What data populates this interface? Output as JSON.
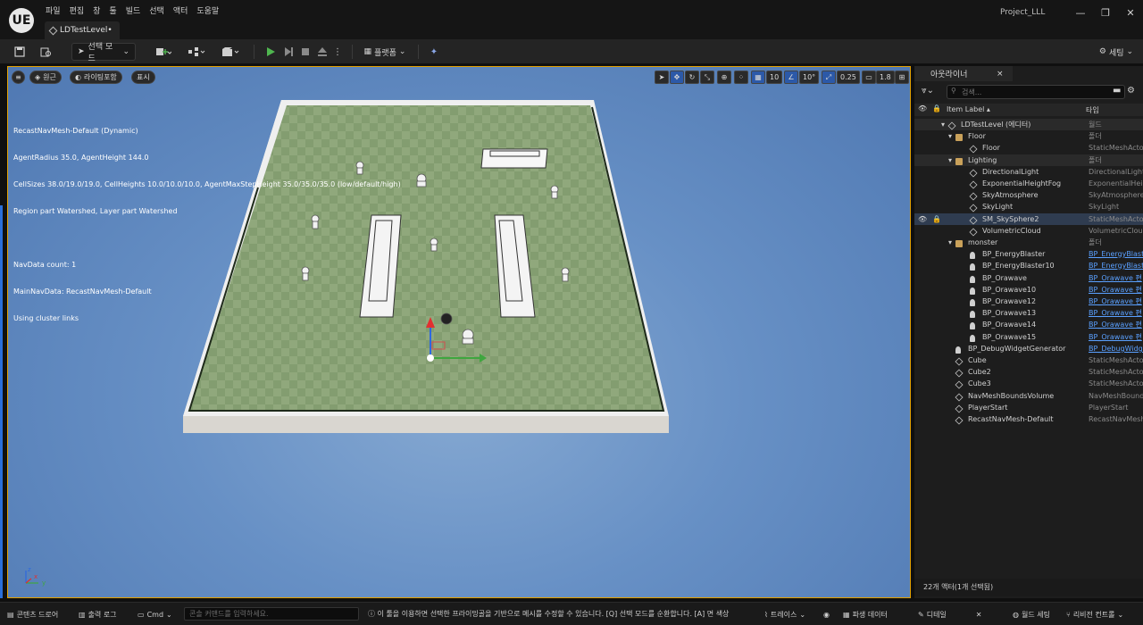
{
  "app": {
    "logo": "UE",
    "project_name": "Project_LLL",
    "menu": [
      "파일",
      "편집",
      "창",
      "툴",
      "빌드",
      "선택",
      "액터",
      "도움말"
    ],
    "level_tab": "LDTestLevel•",
    "window_controls": [
      "—",
      "❐",
      "✕"
    ]
  },
  "toolbar": {
    "mode_label": "선택 모드",
    "platform_label": "플랫폼",
    "settings_label": "세팅"
  },
  "viewport": {
    "perspective_label": "원근",
    "lit_label": "라이팅포함",
    "show_label": "표시",
    "grid_snap": "10",
    "rotation_snap": "10°",
    "scale_snap": "0.25",
    "camera_speed": "1.8",
    "debug_lines": [
      "RecastNavMesh-Default (Dynamic)",
      "AgentRadius 35.0, AgentHeight 144.0",
      "CellSizes 38.0/19.0/19.0, CellHeights 10.0/10.0/10.0, AgentMaxStepHeight 35.0/35.0/35.0 (low/default/high)",
      "Region part Watershed, Layer part Watershed",
      "",
      "NavData count: 1",
      "MainNavData: RecastNavMesh-Default",
      "Using cluster links"
    ],
    "axis": {
      "z": "z",
      "x": "x",
      "y": "y"
    }
  },
  "outliner": {
    "tab_label": "아웃라이너",
    "close": "×",
    "search_placeholder": "검색...",
    "col_label": "Item Label ▴",
    "col_type": "타입",
    "rows": [
      {
        "label": "LDTestLevel (에디터)",
        "type": "월드",
        "icon": "level-icon",
        "indent": 1,
        "link": false,
        "selected": false,
        "hl": true
      },
      {
        "label": "Floor",
        "type": "폴더",
        "icon": "folder-icon",
        "indent": 2,
        "link": false,
        "selected": false,
        "hl": false
      },
      {
        "label": "Floor",
        "type": "StaticMeshActor",
        "icon": "mesh-icon",
        "indent": 3,
        "link": false,
        "selected": false,
        "hl": false
      },
      {
        "label": "Lighting",
        "type": "폴더",
        "icon": "folder-icon",
        "indent": 2,
        "link": false,
        "selected": false,
        "hl": true
      },
      {
        "label": "DirectionalLight",
        "type": "DirectionalLight",
        "icon": "sun-icon",
        "indent": 3,
        "link": false,
        "selected": false,
        "hl": false
      },
      {
        "label": "ExponentialHeightFog",
        "type": "ExponentialHeightFog",
        "icon": "fog-icon",
        "indent": 3,
        "link": false,
        "selected": false,
        "hl": false
      },
      {
        "label": "SkyAtmosphere",
        "type": "SkyAtmosphere",
        "icon": "atmosphere-icon",
        "indent": 3,
        "link": false,
        "selected": false,
        "hl": false
      },
      {
        "label": "SkyLight",
        "type": "SkyLight",
        "icon": "skylight-icon",
        "indent": 3,
        "link": false,
        "selected": false,
        "hl": false
      },
      {
        "label": "SM_SkySphere2",
        "type": "StaticMeshActor",
        "icon": "mesh-icon",
        "indent": 3,
        "link": false,
        "selected": true,
        "hl": false
      },
      {
        "label": "VolumetricCloud",
        "type": "VolumetricCloud",
        "icon": "cloud-icon",
        "indent": 3,
        "link": false,
        "selected": false,
        "hl": false
      },
      {
        "label": "monster",
        "type": "폴더",
        "icon": "folder-icon",
        "indent": 2,
        "link": false,
        "selected": false,
        "hl": false
      },
      {
        "label": "BP_EnergyBlaster",
        "type": "BP_EnergyBlaster",
        "icon": "pawn-icon",
        "indent": 3,
        "link": true,
        "selected": false,
        "hl": false
      },
      {
        "label": "BP_EnergyBlaster10",
        "type": "BP_EnergyBlaster",
        "icon": "pawn-icon",
        "indent": 3,
        "link": true,
        "selected": false,
        "hl": false
      },
      {
        "label": "BP_Orawave",
        "type": "BP_Orawave 편",
        "icon": "pawn-icon",
        "indent": 3,
        "link": true,
        "selected": false,
        "hl": false
      },
      {
        "label": "BP_Orawave10",
        "type": "BP_Orawave 편",
        "icon": "pawn-icon",
        "indent": 3,
        "link": true,
        "selected": false,
        "hl": false
      },
      {
        "label": "BP_Orawave12",
        "type": "BP_Orawave 편",
        "icon": "pawn-icon",
        "indent": 3,
        "link": true,
        "selected": false,
        "hl": false
      },
      {
        "label": "BP_Orawave13",
        "type": "BP_Orawave 편",
        "icon": "pawn-icon",
        "indent": 3,
        "link": true,
        "selected": false,
        "hl": false
      },
      {
        "label": "BP_Orawave14",
        "type": "BP_Orawave 편",
        "icon": "pawn-icon",
        "indent": 3,
        "link": true,
        "selected": false,
        "hl": false
      },
      {
        "label": "BP_Orawave15",
        "type": "BP_Orawave 편",
        "icon": "pawn-icon",
        "indent": 3,
        "link": true,
        "selected": false,
        "hl": false
      },
      {
        "label": "BP_DebugWidgetGenerator",
        "type": "BP_DebugWidget",
        "icon": "pawn-icon",
        "indent": 2,
        "link": true,
        "selected": false,
        "hl": false
      },
      {
        "label": "Cube",
        "type": "StaticMeshActor",
        "icon": "mesh-icon",
        "indent": 2,
        "link": false,
        "selected": false,
        "hl": false
      },
      {
        "label": "Cube2",
        "type": "StaticMeshActor",
        "icon": "mesh-icon",
        "indent": 2,
        "link": false,
        "selected": false,
        "hl": false
      },
      {
        "label": "Cube3",
        "type": "StaticMeshActor",
        "icon": "mesh-icon",
        "indent": 2,
        "link": false,
        "selected": false,
        "hl": false
      },
      {
        "label": "NavMeshBoundsVolume",
        "type": "NavMeshBoundsVolume",
        "icon": "volume-icon",
        "indent": 2,
        "link": false,
        "selected": false,
        "hl": false
      },
      {
        "label": "PlayerStart",
        "type": "PlayerStart",
        "icon": "flag-icon",
        "indent": 2,
        "link": false,
        "selected": false,
        "hl": false
      },
      {
        "label": "RecastNavMesh-Default",
        "type": "RecastNavMesh",
        "icon": "navmesh-icon",
        "indent": 2,
        "link": false,
        "selected": false,
        "hl": false
      }
    ],
    "status": "22개 액터(1개 선택됨)"
  },
  "bottombar": {
    "content_drawer": "콘텐츠 드로어",
    "output_log": "출력 로그",
    "cmd": "Cmd",
    "cmd_placeholder": "콘솔 커맨드를 입력하세요.",
    "hint": "이 툴을 이용하면 선택한 프라이밍골을 기반으로 메시를 수정할 수 있습니다. [Q] 선택 모드를 순환합니다. [A] 면 색상",
    "trace": "트레이스",
    "derived_data": "파생 데이터",
    "detail_tab": "디테일",
    "world_settings": "월드 세팅",
    "revision": "리비전 컨트롤"
  }
}
